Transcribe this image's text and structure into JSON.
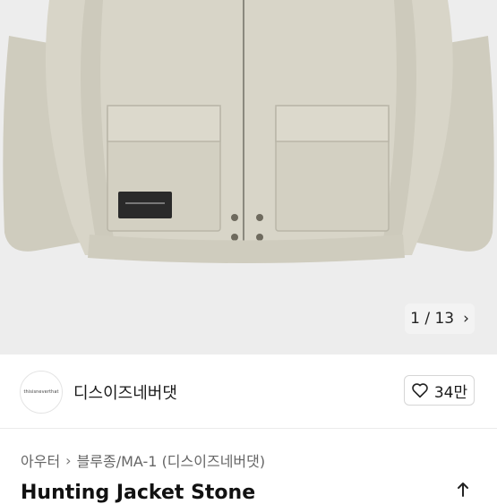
{
  "gallery": {
    "current": "1",
    "separator": "/",
    "total": "13",
    "counter_text": "1 / 13"
  },
  "seller": {
    "avatar_text": "thisisneverthat",
    "name": "디스이즈네버댓"
  },
  "like": {
    "count": "34만",
    "icon": "heart-outline-icon"
  },
  "breadcrumb": [
    {
      "label": "아우터"
    },
    {
      "label": "블루종/MA-1 (디스이즈네버댓)"
    }
  ],
  "product": {
    "title": "Hunting Jacket Stone"
  },
  "colors": {
    "jacket": "#d6d3c6",
    "background": "#ededed",
    "accent": "#1d1d1f"
  }
}
